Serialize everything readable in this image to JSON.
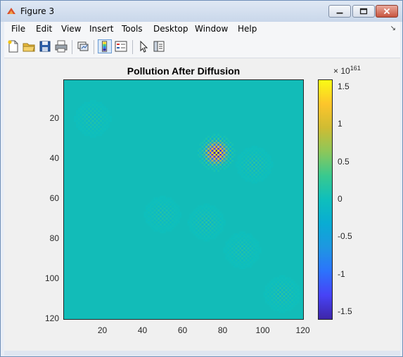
{
  "window": {
    "title": "Figure 3",
    "controls": [
      "minimize",
      "maximize",
      "close"
    ]
  },
  "menubar": {
    "items": [
      "File",
      "Edit",
      "View",
      "Insert",
      "Tools",
      "Desktop",
      "Window",
      "Help"
    ]
  },
  "toolbar": {
    "tools": [
      "new-figure",
      "open-file",
      "save",
      "print",
      "link-plot",
      "insert-colorbar",
      "insert-legend",
      "edit-plot",
      "show-plot-tools"
    ]
  },
  "colors": {
    "heatmap_background": "#12bcb8",
    "bright_spot": "#f9fb15",
    "dark_spot": "#6a3fa8"
  },
  "chart_data": {
    "type": "heatmap",
    "title": "Pollution After Diffusion",
    "xlim": [
      0.5,
      120.5
    ],
    "ylim": [
      0.5,
      120.5
    ],
    "y_reversed": true,
    "xticks": [
      "20",
      "40",
      "60",
      "80",
      "100",
      "120"
    ],
    "yticks": [
      "20",
      "40",
      "60",
      "80",
      "100",
      "120"
    ],
    "hotspots": [
      {
        "x": 77,
        "y": 37,
        "amplitude": 1.6
      },
      {
        "x": 15,
        "y": 20,
        "amplitude": 0.15
      },
      {
        "x": 96,
        "y": 43,
        "amplitude": 0.2
      },
      {
        "x": 50,
        "y": 68,
        "amplitude": 0.15
      },
      {
        "x": 72,
        "y": 72,
        "amplitude": 0.2
      },
      {
        "x": 90,
        "y": 86,
        "amplitude": 0.15
      },
      {
        "x": 110,
        "y": 108,
        "amplitude": 0.2
      }
    ],
    "colorbar": {
      "exponent_base": "× 10",
      "exponent_power": "161",
      "range": [
        -1.6,
        1.6
      ],
      "tick_values": [
        1.5,
        1,
        0.5,
        0,
        -0.5,
        -1,
        -1.5
      ],
      "tick_labels": [
        "1.5",
        "1",
        "0.5",
        "0",
        "-0.5",
        "-1",
        "-1.5"
      ],
      "colormap": "parula"
    }
  }
}
